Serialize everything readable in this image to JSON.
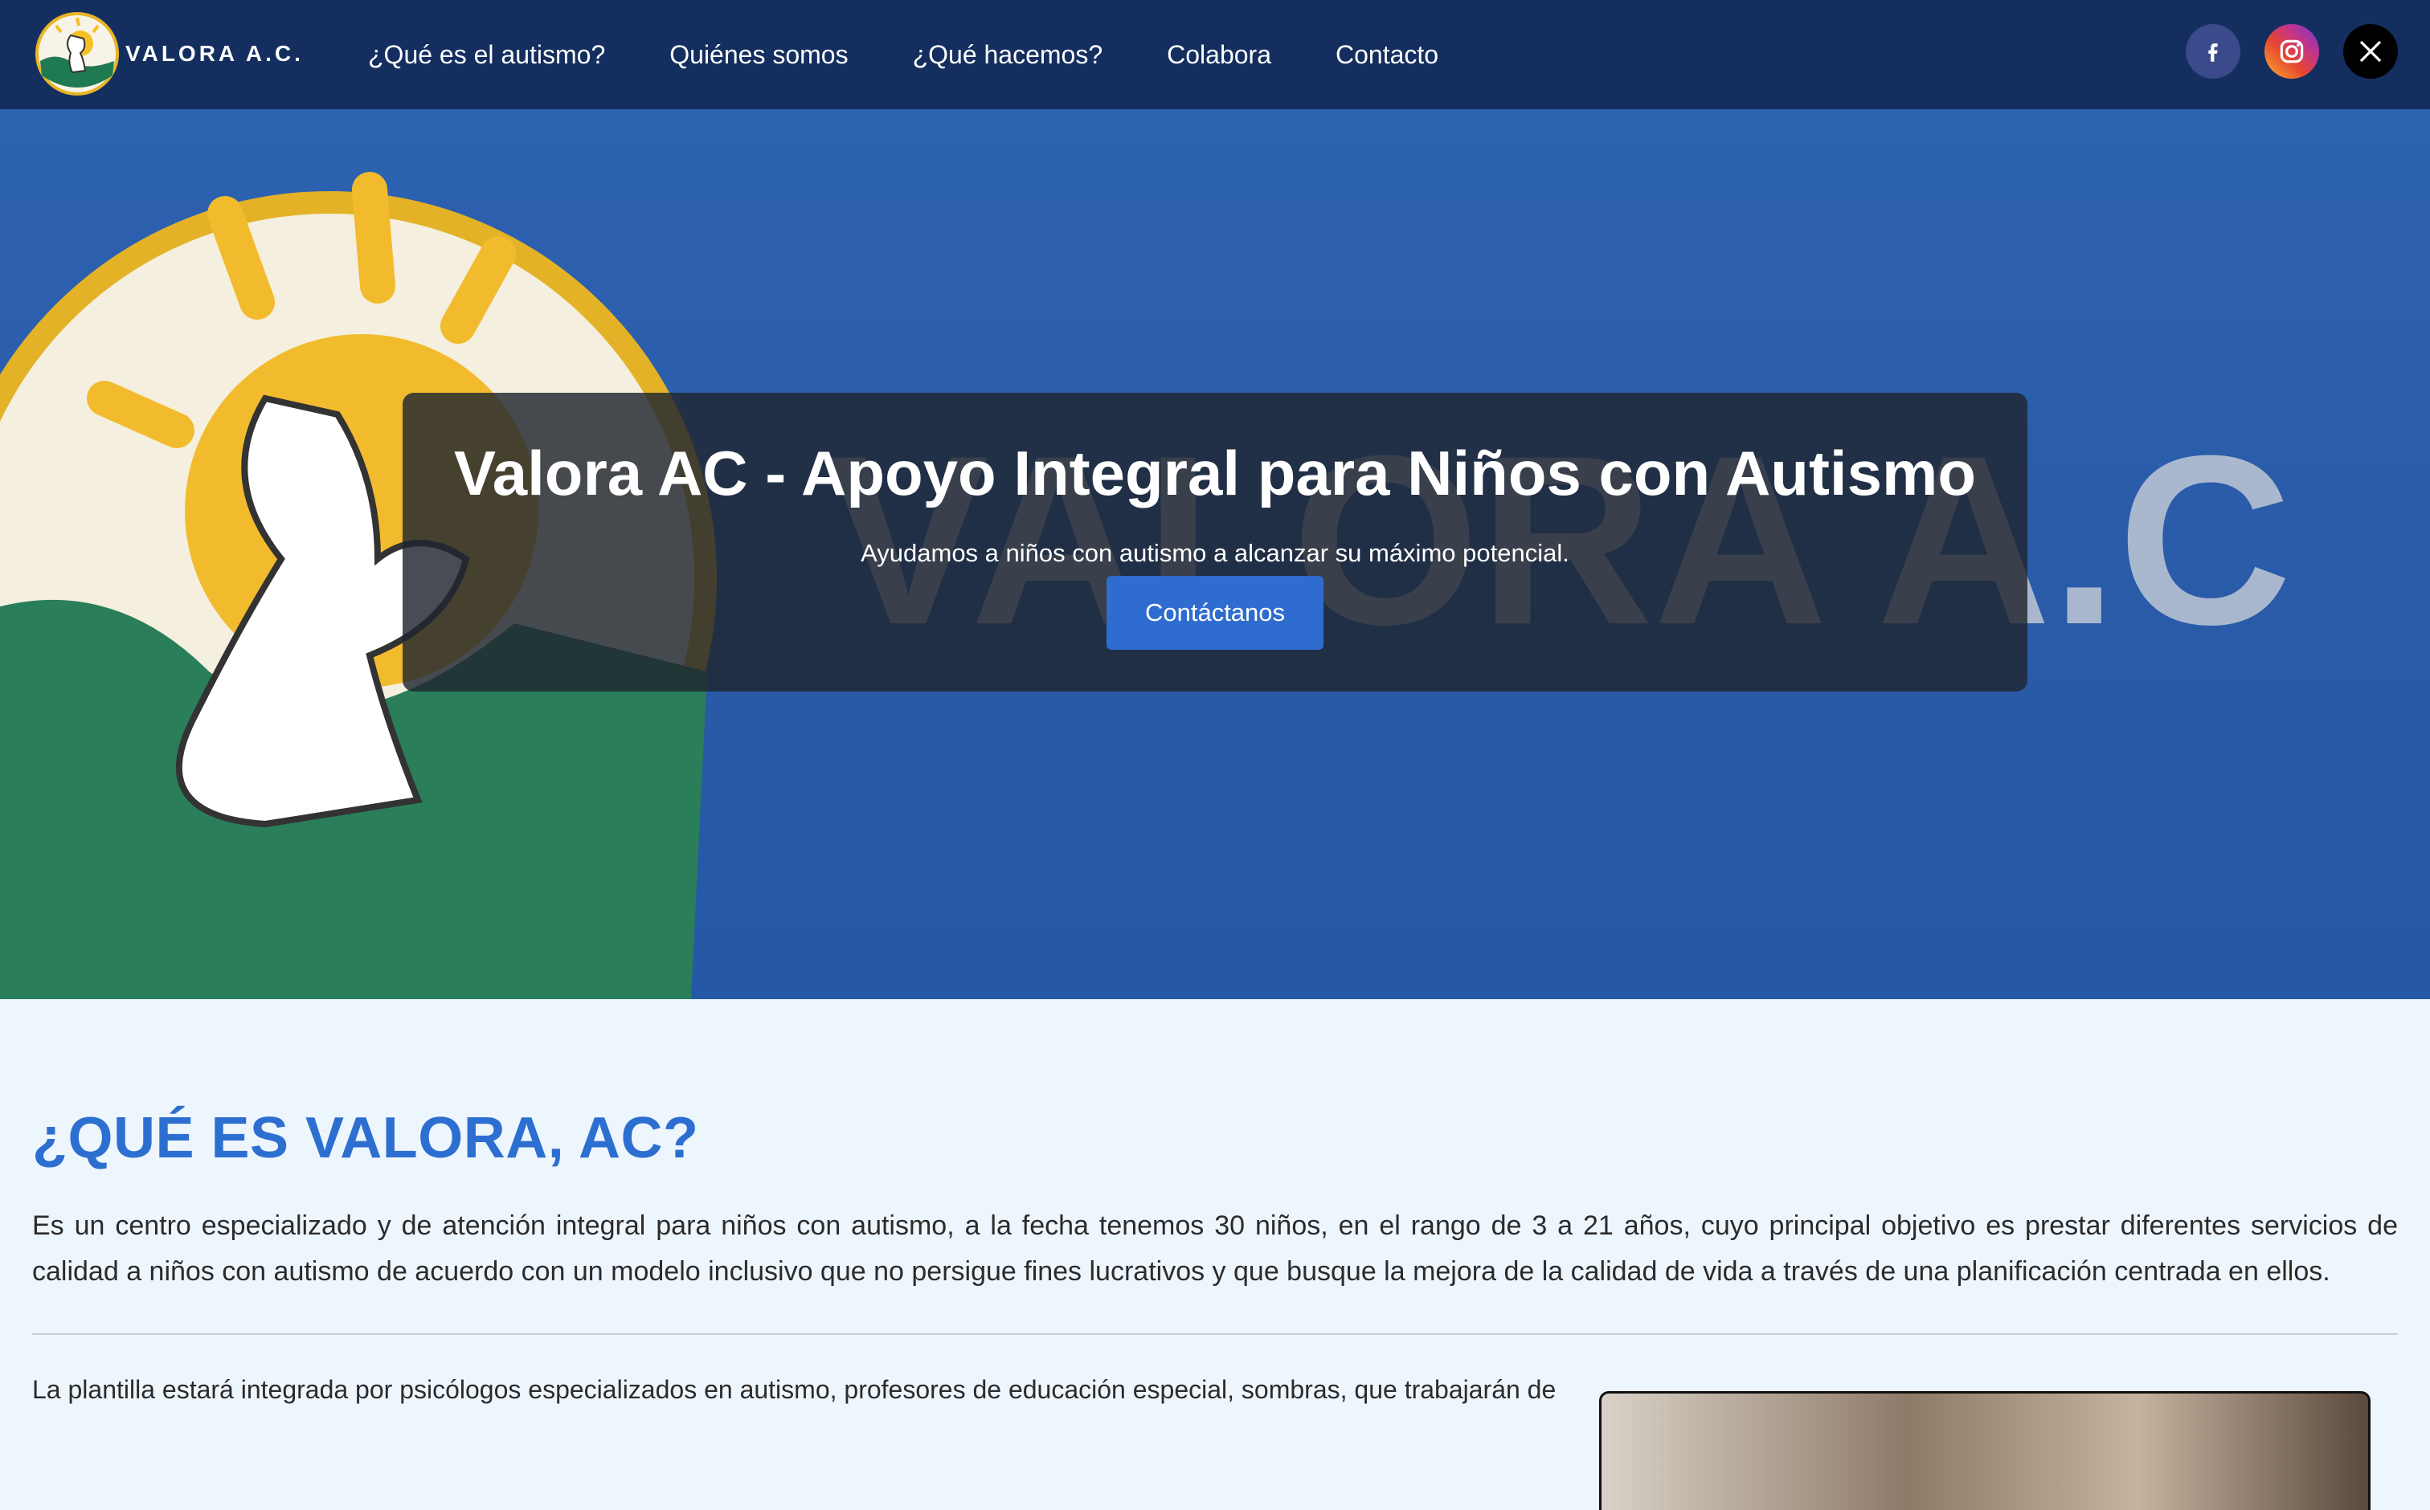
{
  "brand": {
    "name": "VALORA A.C."
  },
  "nav": {
    "items": [
      {
        "label": "¿Qué es el autismo?"
      },
      {
        "label": "Quiénes somos"
      },
      {
        "label": "¿Qué hacemos?"
      },
      {
        "label": "Colabora"
      },
      {
        "label": "Contacto"
      }
    ]
  },
  "social": {
    "icons": [
      "facebook-icon",
      "instagram-icon",
      "x-icon"
    ]
  },
  "hero": {
    "title": "Valora AC - Apoyo Integral para Niños con Autismo",
    "subtitle": "Ayudamos a niños con autismo a alcanzar su máximo potencial.",
    "button_label": "Contáctanos",
    "background_text": "VALORA A.C"
  },
  "about": {
    "title": "¿QUÉ ES VALORA, AC?",
    "text": "Es un centro especializado y de atención integral para niños con autismo, a la fecha tenemos 30 niños, en el rango de 3 a 21 años, cuyo principal objetivo es prestar diferentes servicios de calidad a niños con autismo de acuerdo con un modelo inclusivo que no persigue fines lucrativos y que busque la mejora de la calidad de vida a través de una planificación centrada en ellos.",
    "team_text": "La plantilla estará integrada por psicólogos especializados en autismo, profesores de educación especial, sombras, que trabajarán de"
  },
  "colors": {
    "navbar": "#142f5f",
    "accent": "#2c6fd1",
    "button": "#2f6cd0",
    "background": "#eef6fd"
  }
}
